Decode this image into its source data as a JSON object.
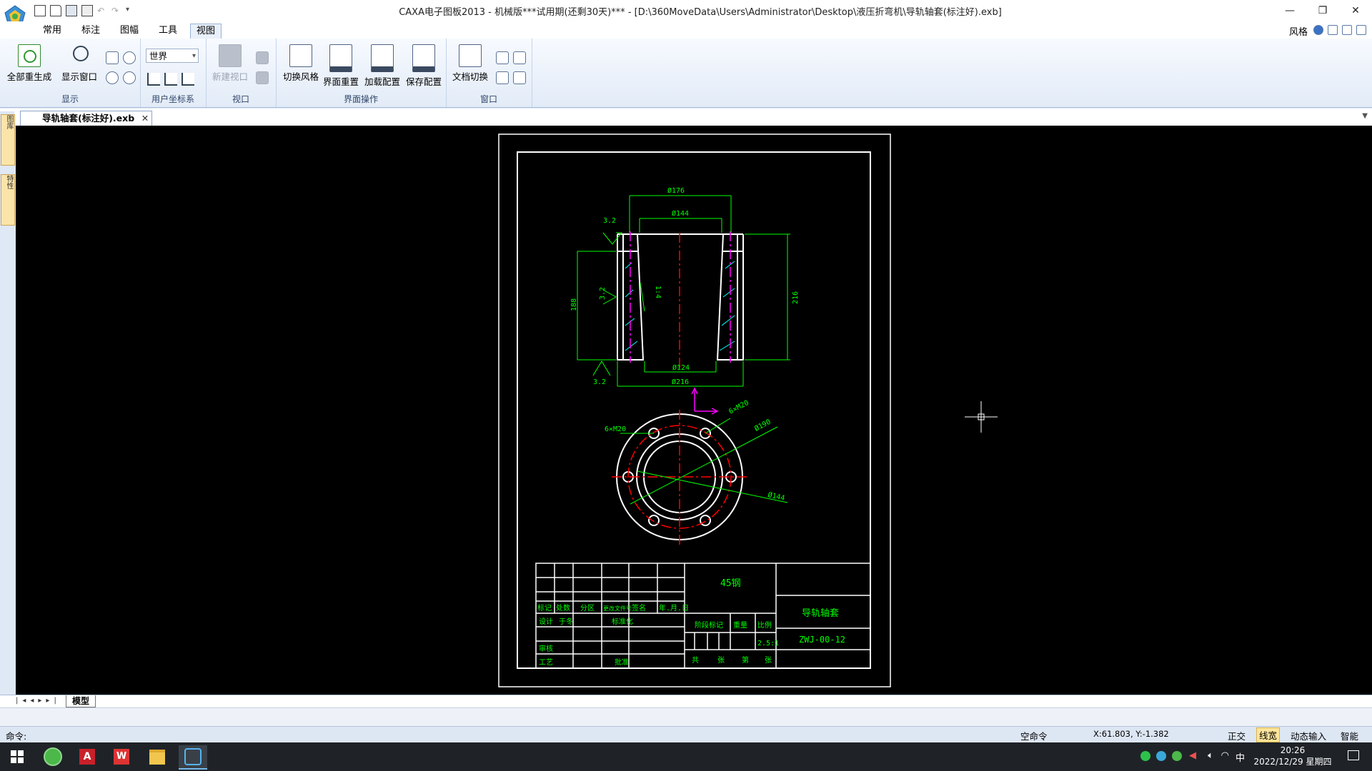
{
  "window": {
    "title": "CAXA电子图板2013 - 机械版***试用期(还剩30天)*** - [D:\\360MoveData\\Users\\Administrator\\Desktop\\液压折弯机\\导轨轴套(标注好).exb]",
    "controls": [
      "—",
      "❐",
      "✕"
    ]
  },
  "ribbon_tabs": [
    "常用",
    "标注",
    "图幅",
    "工具",
    "视图"
  ],
  "active_tab": "视图",
  "style_menu": "风格",
  "ribbon": {
    "display_group": {
      "label": "显示",
      "regen_all": "全部重生成",
      "show_window": "显示窗口"
    },
    "ucs_group": {
      "label": "用户坐标系",
      "select_value": "世界"
    },
    "viewport_group": {
      "label": "视口",
      "new_viewport": "新建视口"
    },
    "ui_group": {
      "label": "界面操作",
      "switch_style": "切换风格",
      "reset_ui": "界面重置",
      "load_config": "加载配置",
      "save_config": "保存配置"
    },
    "window_group": {
      "label": "窗口",
      "doc_switch": "文档切换"
    }
  },
  "document_tab": "导轨轴套(标注好).exb",
  "side_tabs": [
    "图库",
    "特性"
  ],
  "drawing": {
    "dims": {
      "d176": "Ø176",
      "d144": "Ø144",
      "d124": "Ø124",
      "d216": "Ø216",
      "h188": "188",
      "h216": "216",
      "r32a": "3.2",
      "r32b": "3.2",
      "r32c": "3.2",
      "hole1": "6×M20",
      "hole2": "6×M20",
      "pcd": "Ø190",
      "bore": "Ø144",
      "angle": "1:4"
    },
    "title_block": {
      "material": "45钢",
      "part_name": "导轨轴套",
      "drawing_no": "ZWJ-00-12",
      "scale": "2.5:1",
      "row_labels": [
        "标记",
        "处数",
        "分区",
        "更改文件号",
        "签名",
        "年.月.日"
      ],
      "design": "设计",
      "design_name": "于冬",
      "standardize": "标准化",
      "review": "审核",
      "craft": "工艺",
      "approve": "批准",
      "stage_mark": "阶段标记",
      "weight": "重量",
      "ratio": "比例",
      "sheets": [
        "共",
        "张",
        "第",
        "张"
      ]
    }
  },
  "sheet_tab": "模型",
  "command_label": "命令:",
  "status": {
    "no_command": "空命令",
    "coords": "X:61.803, Y:-1.382",
    "ortho": "正交",
    "linewidth": "线宽",
    "dyn_input": "动态输入",
    "smart": "智能"
  },
  "taskbar": {
    "time": "20:26",
    "date": "2022/12/29 星期四",
    "ime": "中"
  },
  "colors": {
    "accent": "#2b5797",
    "drawing_bg": "#000000",
    "dim_green": "#00ff00",
    "center_red": "#ff0000",
    "hatch_cyan": "#00ffff",
    "magenta": "#ff00ff"
  }
}
